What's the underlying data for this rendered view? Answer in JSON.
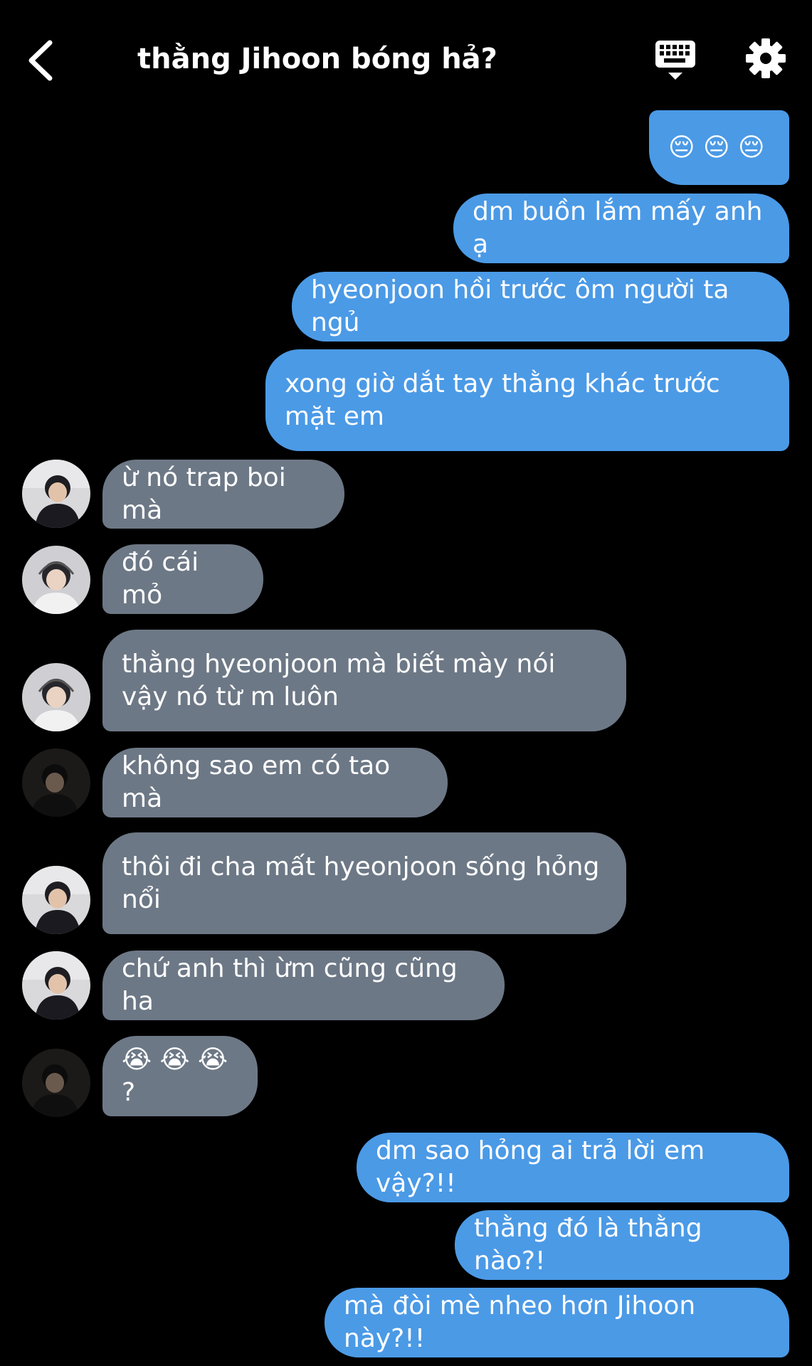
{
  "header": {
    "title": "thằng Jihoon bóng hả?"
  },
  "colors": {
    "background": "#000000",
    "outgoing_bubble": "#4b9ae6",
    "incoming_bubble": "#6d7886",
    "text": "#ffffff"
  },
  "icons": {
    "back": "chevron-left-icon",
    "keyboard": "keyboard-icon",
    "settings": "gear-icon",
    "pensive": "pensive-face-emoji",
    "crying": "loudly-crying-face-emoji"
  },
  "messages": [
    {
      "side": "out",
      "text": "😔 😔 😔"
    },
    {
      "side": "out",
      "text": "dm buồn lắm mấy anh ạ"
    },
    {
      "side": "out",
      "text": "hyeonjoon hồi trước ôm người ta ngủ"
    },
    {
      "side": "out",
      "text": "xong giờ dắt tay thằng khác trước mặt em"
    },
    {
      "side": "in",
      "text": "ừ nó trap boi mà"
    },
    {
      "side": "in",
      "text": "đó cái mỏ"
    },
    {
      "side": "in",
      "text": "thằng hyeonjoon mà biết mày nói vậy nó từ m luôn"
    },
    {
      "side": "in",
      "text": "không sao em có tao mà"
    },
    {
      "side": "in",
      "text": "thôi đi cha mất hyeonjoon sống hỏng nổi"
    },
    {
      "side": "in",
      "text": "chứ anh thì ừm cũng cũng ha"
    },
    {
      "side": "in",
      "text": "😭 😭 😭 ?"
    },
    {
      "side": "out",
      "text": "dm sao hỏng ai trả lời em vậy?!!"
    },
    {
      "side": "out",
      "text": "thằng đó là thằng nào?!"
    },
    {
      "side": "out",
      "text": "mà đòi mè nheo hơn Jihoon này?!!"
    }
  ]
}
